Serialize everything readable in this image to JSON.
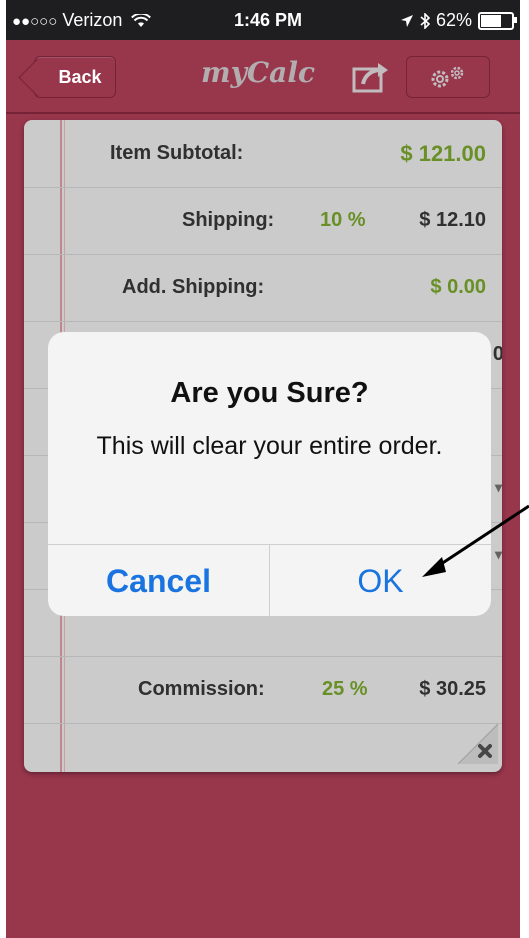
{
  "status": {
    "signal": "●●○○○",
    "carrier": "Verizon",
    "wifi": "wifi-icon",
    "time": "1:46 PM",
    "battery": "62%"
  },
  "nav": {
    "back": "Back",
    "title": "myCalc",
    "share_icon": "share-icon",
    "settings_icon": "gears-icon"
  },
  "rows": [
    {
      "label": "Item Subtotal:",
      "value": "$ 121.00"
    },
    {
      "label": "Shipping:",
      "pct": "10 %",
      "value": "$ 12.10"
    },
    {
      "label": "Add. Shipping:",
      "value": "$ 0.00"
    },
    {
      "label": "Commission:",
      "pct": "25 %",
      "value": "$ 30.25"
    }
  ],
  "peeks": [
    "0",
    "▾",
    "▾"
  ],
  "colors": {
    "accent": "#b7415c",
    "green": "#7fae2f",
    "link": "#1a74e0"
  },
  "alert": {
    "title": "Are you Sure?",
    "message": "This will clear your entire order.",
    "cancel": "Cancel",
    "ok": "OK"
  }
}
